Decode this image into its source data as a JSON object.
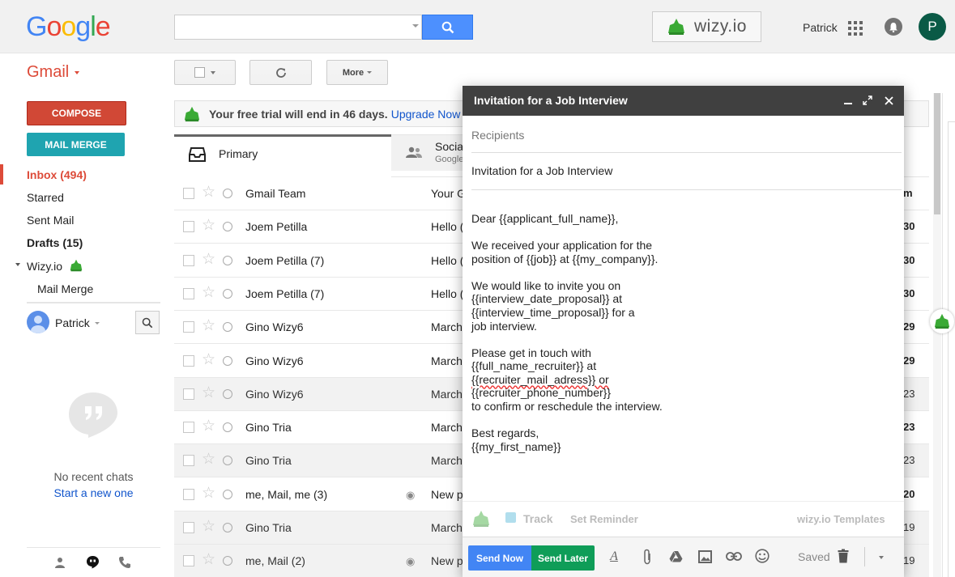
{
  "header": {
    "logo": "Google",
    "logo_colors": [
      "#4285f4",
      "#ea4335",
      "#fbbc05",
      "#4285f4",
      "#34a853",
      "#ea4335"
    ],
    "search": {
      "value": "",
      "placeholder": ""
    },
    "wizy_badge": "wizy.io",
    "user_name": "Patrick",
    "avatar_initial": "P"
  },
  "toolbar": {
    "app_label": "Gmail",
    "more_label": "More"
  },
  "sidebar": {
    "compose_label": "COMPOSE",
    "mailmerge_label": "MAIL MERGE",
    "items": [
      {
        "label": "Inbox (494)"
      },
      {
        "label": "Starred"
      },
      {
        "label": "Sent Mail"
      },
      {
        "label": "Drafts (15)"
      },
      {
        "label": "Wizy.io"
      },
      {
        "label": "Mail Merge"
      }
    ],
    "chat_user": "Patrick",
    "no_chats": "No recent chats",
    "start_chat": "Start a new one"
  },
  "trial": {
    "text": "Your free trial will end in 46 days.",
    "link": "Upgrade Now"
  },
  "tabs": [
    {
      "label": "Primary"
    },
    {
      "label": "Socia",
      "sub": "Google"
    }
  ],
  "emails": [
    {
      "sender": "Gmail Team",
      "subject": "Your G",
      "date": "m",
      "unread": true
    },
    {
      "sender": "Joem Petilla",
      "subject": "Hello (",
      "date": "30",
      "unread": true
    },
    {
      "sender": "Joem Petilla (7)",
      "subject": "Hello (",
      "date": "30",
      "unread": true
    },
    {
      "sender": "Joem Petilla (7)",
      "subject": "Hello (",
      "date": "30",
      "unread": true
    },
    {
      "sender": "Gino Wizy6",
      "subject": "March",
      "date": "29",
      "unread": true
    },
    {
      "sender": "Gino Wizy6",
      "subject": "March",
      "date": "29",
      "unread": true
    },
    {
      "sender": "Gino Wizy6",
      "subject": "March",
      "date": "23",
      "unread": false
    },
    {
      "sender": "Gino Tria",
      "subject": "March",
      "date": "23",
      "unread": true
    },
    {
      "sender": "Gino Tria",
      "subject": "March",
      "date": "23",
      "unread": false
    },
    {
      "sender": "me, Mail, me (3)",
      "subject": "New p",
      "date": "20",
      "unread": true
    },
    {
      "sender": "Gino Tria",
      "subject": "March",
      "date": "19",
      "unread": false
    },
    {
      "sender": "me, Mail (2)",
      "subject": "New p",
      "date": "19",
      "unread": false
    }
  ],
  "compose": {
    "title": "Invitation for a Job Interview",
    "recipients_placeholder": "Recipients",
    "subject": "Invitation for a Job Interview",
    "body": {
      "greeting": "Dear {{applicant_full_name}},",
      "p1_l1": "We received your application for the",
      "p1_l2": "position of {{job}} at {{my_company}}.",
      "p2_l1": "We would like to invite you on",
      "p2_l2": "{{interview_date_proposal}} at",
      "p2_l3": "{{interview_time_proposal}} for a",
      "p2_l4": "job interview.",
      "p3_l1": "Please get in touch with",
      "p3_l2": "{{full_name_recruiter}} at",
      "p3_l3": "{{recruiter_mail_adress}} or",
      "p3_l4": "{{recruiter_phone_number}}",
      "p3_l5": "to confirm or reschedule the interview.",
      "closing": "Best regards,",
      "signature": "{{my_first_name}}"
    },
    "track_label": "Track",
    "reminder_label": "Set Reminder",
    "templates_label": "wizy.io Templates",
    "send_now": "Send Now",
    "send_later": "Send Later",
    "saved": "Saved"
  },
  "colors": {
    "gmail_red": "#dd4b39",
    "compose_red": "#d14836",
    "mailmerge_teal": "#1fa4b0",
    "send_blue": "#4285f4",
    "send_green": "#0f9d58",
    "link": "#1155cc",
    "wizy_green": "#3aaa35"
  }
}
